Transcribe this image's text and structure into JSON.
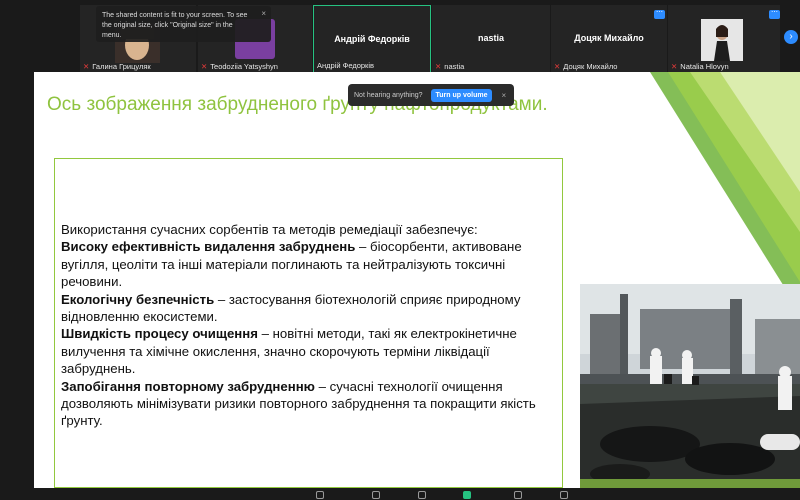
{
  "meeting": {
    "tooltip_text": "The shared content is fit to your screen. To see the original size, click \"Original size\" in the menu.",
    "tooltip_close": "×",
    "more_glyph": "⋯",
    "nav_glyph": "›",
    "mic_glyph": "✕",
    "participants": [
      {
        "label": "Галина Грицуляк",
        "name": ""
      },
      {
        "label": "Teodoziia Yatsyshyn",
        "name": ""
      },
      {
        "label": "Андрій Федорків",
        "name": "Андрій Федорків"
      },
      {
        "label": "nastia",
        "name": "nastia"
      },
      {
        "label": "Доцяк Михайло",
        "name": "Доцяк Михайло"
      },
      {
        "label": "Natalia Hlovyn",
        "name": ""
      }
    ]
  },
  "notice": {
    "text": "Not hearing anything?",
    "button": "Turn up volume",
    "close": "×"
  },
  "slide": {
    "title": "Ось зображення забрудненого ґрунту нафтопродуктами.",
    "intro": "Використання сучасних сорбентів та методів ремедіації забезпечує:",
    "items": [
      {
        "heading": "Високу ефективність видалення забруднень",
        "text": " – біосорбенти, активоване вугілля, цеоліти та інші матеріали поглинають та нейтралізують токсичні речовини."
      },
      {
        "heading": "Екологічну безпечність",
        "text": " – застосування біотехнологій сприяє природному відновленню екосистеми."
      },
      {
        "heading": "Швидкість процесу очищення",
        "text": " – новітні методи, такі як електрокінетичне вилучення та хімічне окислення, значно скорочують терміни ліквідації забруднень."
      },
      {
        "heading": "Запобігання повторному забрудненню",
        "text": " – сучасні технології очищення дозволяють мінімізувати ризики повторного забруднення та покращити якість ґрунту."
      }
    ]
  },
  "colors": {
    "accent_green": "#8fc33f",
    "zoom_blue": "#2d8cff",
    "active_border": "#26c281",
    "mic_off_red": "#e03a3a"
  }
}
